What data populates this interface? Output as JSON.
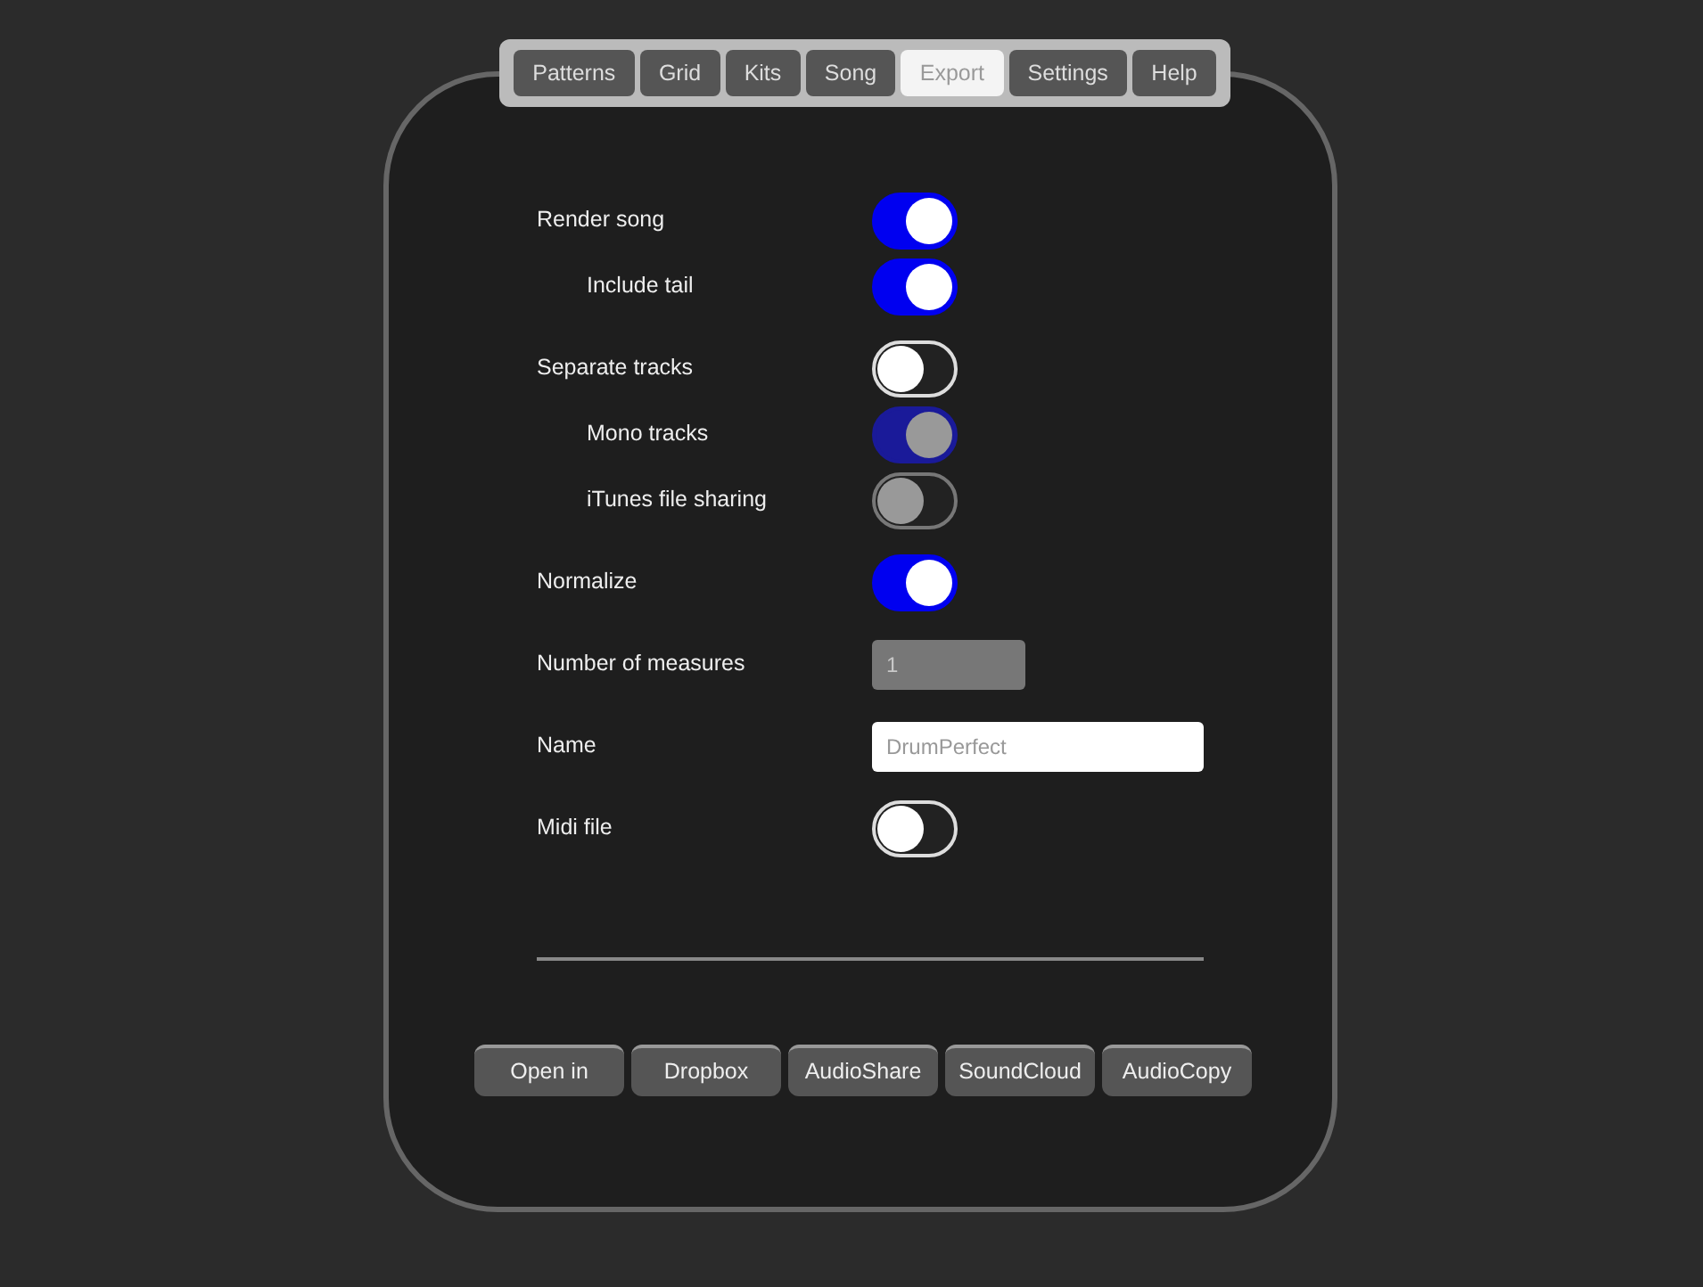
{
  "tabs": [
    {
      "label": "Patterns",
      "selected": false
    },
    {
      "label": "Grid",
      "selected": false
    },
    {
      "label": "Kits",
      "selected": false
    },
    {
      "label": "Song",
      "selected": false
    },
    {
      "label": "Export",
      "selected": true
    },
    {
      "label": "Settings",
      "selected": false
    },
    {
      "label": "Help",
      "selected": false
    }
  ],
  "settings": [
    {
      "kind": "toggle",
      "label": "Render song",
      "on": true,
      "disabled": false,
      "children": [
        {
          "kind": "toggle",
          "label": "Include tail",
          "on": true,
          "disabled": false
        }
      ]
    },
    {
      "kind": "toggle",
      "label": "Separate tracks",
      "on": false,
      "disabled": false,
      "children": [
        {
          "kind": "toggle",
          "label": "Mono tracks",
          "on": true,
          "disabled": true
        },
        {
          "kind": "toggle",
          "label": "iTunes file sharing",
          "on": false,
          "disabled": true
        }
      ]
    },
    {
      "kind": "toggle",
      "label": "Normalize",
      "on": true,
      "disabled": false
    },
    {
      "kind": "field",
      "label": "Number of measures",
      "value": "1",
      "disabled": true
    },
    {
      "kind": "field",
      "label": "Name",
      "value": "DrumPerfect",
      "disabled": false
    },
    {
      "kind": "toggle",
      "label": "Midi file",
      "on": false,
      "disabled": false
    }
  ],
  "buttons": [
    "Open in",
    "Dropbox",
    "AudioShare",
    "SoundCloud",
    "AudioCopy"
  ]
}
